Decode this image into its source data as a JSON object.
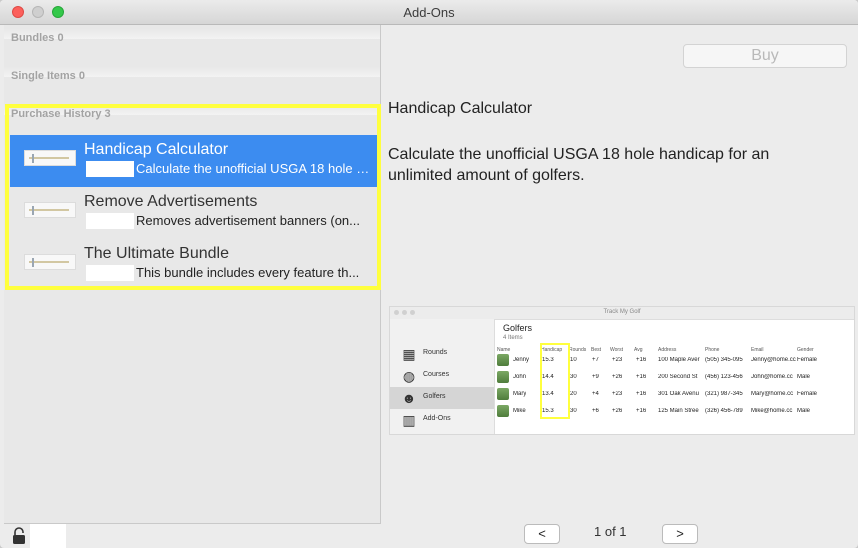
{
  "window": {
    "title": "Add-Ons"
  },
  "sidebar": {
    "sections": [
      {
        "label": "Bundles 0"
      },
      {
        "label": "Single Items 0"
      },
      {
        "label": "Purchase History 3"
      }
    ],
    "items": [
      {
        "title": "Handicap Calculator",
        "desc": "Calculate the unofficial USGA 18 hole handicap for an unlimited amount of golfers."
      },
      {
        "title": "Remove Advertisements",
        "desc": "Removes advertisement banners (on..."
      },
      {
        "title": "The Ultimate Bundle",
        "desc": "This bundle includes every feature th..."
      }
    ]
  },
  "detail": {
    "buy_label": "Buy",
    "title": "Handicap Calculator",
    "description": "Calculate the unofficial USGA 18 hole handicap for an unlimited amount of golfers."
  },
  "preview": {
    "app_title": "Track My Golf",
    "nav": [
      "Rounds",
      "Courses",
      "Golfers",
      "Add-Ons"
    ],
    "heading": "Golfers",
    "count": "4 Items",
    "columns": [
      "Name",
      "Handicap",
      "Rounds",
      "Best",
      "Worst",
      "Avg",
      "Address",
      "Phone",
      "Email",
      "Gender"
    ],
    "rows": [
      [
        "Jenny",
        "15.3",
        "10",
        "+7",
        "+23",
        "+16",
        "100 Maple Aver",
        "(505) 345-095",
        "Jenny@home.cc",
        "Female"
      ],
      [
        "John",
        "14.4",
        "30",
        "+9",
        "+26",
        "+16",
        "200 Second St",
        "(456) 123-456",
        "John@home.cc",
        "Male"
      ],
      [
        "Mary",
        "13.4",
        "20",
        "+4",
        "+23",
        "+16",
        "301 Oak Avenu",
        "(321) 987-345",
        "Mary@home.cc",
        "Female"
      ],
      [
        "Mike",
        "15.3",
        "30",
        "+6",
        "+26",
        "+16",
        "125 Main Stree",
        "(326) 456-789",
        "Mike@home.cc",
        "Male"
      ]
    ]
  },
  "pager": {
    "prev": "<",
    "label": "1 of 1",
    "next": ">"
  }
}
